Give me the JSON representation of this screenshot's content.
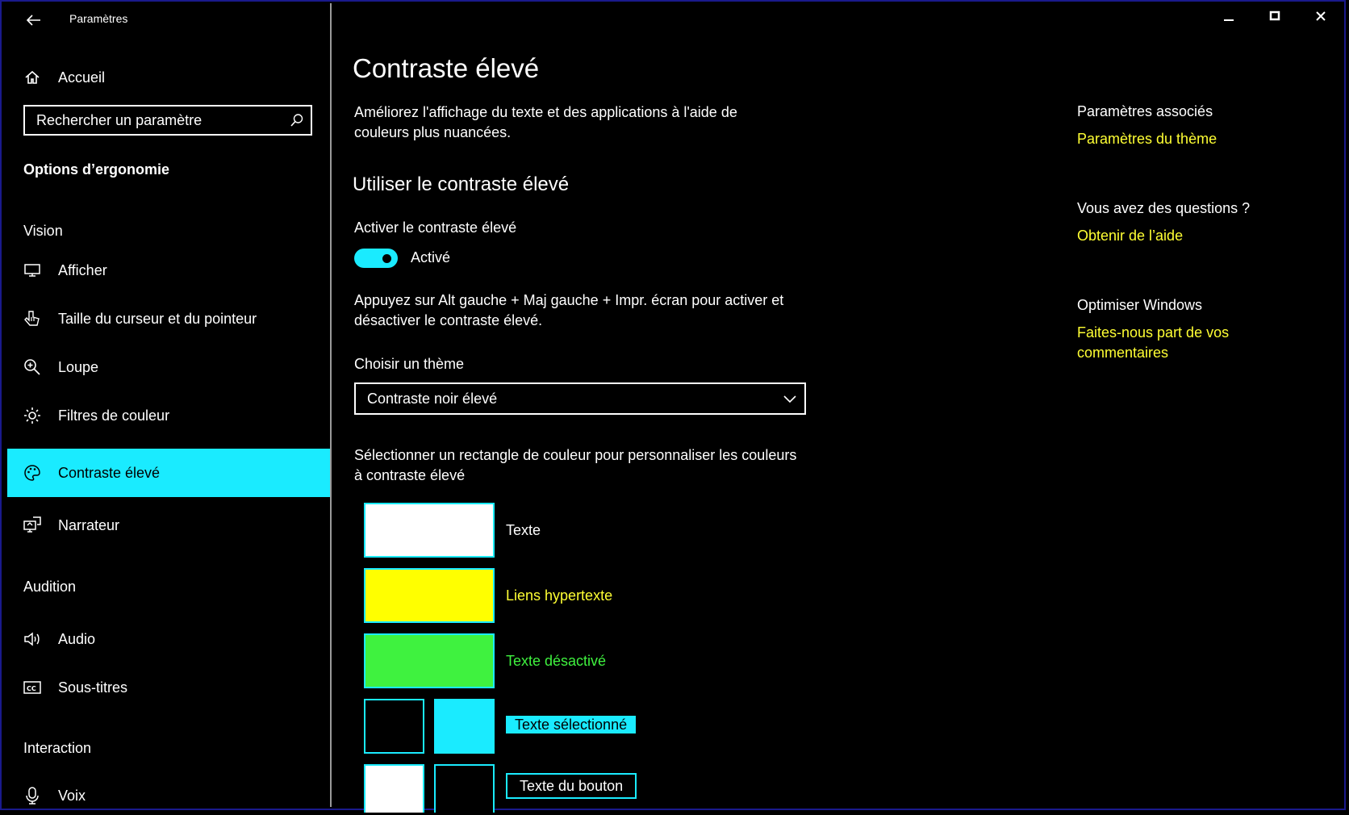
{
  "window": {
    "title": "Paramètres",
    "minimize_glyph": "—",
    "close_glyph": "✕"
  },
  "sidebar": {
    "home_label": "Accueil",
    "search_placeholder": "Rechercher un paramètre",
    "section_title": "Options d’ergonomie",
    "groups": {
      "vision": "Vision",
      "audition": "Audition",
      "interaction": "Interaction"
    },
    "items": [
      {
        "label": "Afficher",
        "icon": "monitor-icon"
      },
      {
        "label": "Taille du curseur et du pointeur",
        "icon": "pointer-icon"
      },
      {
        "label": "Loupe",
        "icon": "magnifier-icon"
      },
      {
        "label": "Filtres de couleur",
        "icon": "sun-icon"
      },
      {
        "label": "Contraste élevé",
        "icon": "palette-icon",
        "active": true
      },
      {
        "label": "Narrateur",
        "icon": "narrator-icon"
      },
      {
        "label": "Audio",
        "icon": "speaker-icon"
      },
      {
        "label": "Sous-titres",
        "icon": "cc-icon"
      },
      {
        "label": "Voix",
        "icon": "microphone-icon"
      }
    ]
  },
  "main": {
    "title": "Contraste élevé",
    "description": "Améliorez l'affichage du texte et des applications à l'aide de couleurs plus nuancées.",
    "section_title": "Utiliser le contraste élevé",
    "toggle_label": "Activer le contraste élevé",
    "toggle_state": "Activé",
    "toggle_on": true,
    "shortcut_text": "Appuyez sur Alt gauche + Maj gauche + Impr. écran pour activer et désactiver le contraste élevé.",
    "theme_label": "Choisir un thème",
    "theme_value": "Contraste noir élevé",
    "swatch_instructions": "Sélectionner un rectangle de couleur pour personnaliser les couleurs à contraste élevé",
    "swatches": {
      "text": "Texte",
      "hyperlinks": "Liens hypertexte",
      "disabled": "Texte désactivé",
      "selected": "Texte sélectionné",
      "button": "Texte du bouton"
    }
  },
  "related": {
    "heading": "Paramètres associés",
    "theme_link": "Paramètres du thème",
    "questions_heading": "Vous avez des questions ?",
    "help_link": "Obtenir de l’aide",
    "optimize_heading": "Optimiser Windows",
    "feedback_link": "Faites-nous part de vos commentaires"
  },
  "colors": {
    "accent": "#1AEBFF",
    "link": "#FFFF00",
    "disabled": "#3FF23F",
    "background": "#000000",
    "text": "#FFFFFF"
  }
}
